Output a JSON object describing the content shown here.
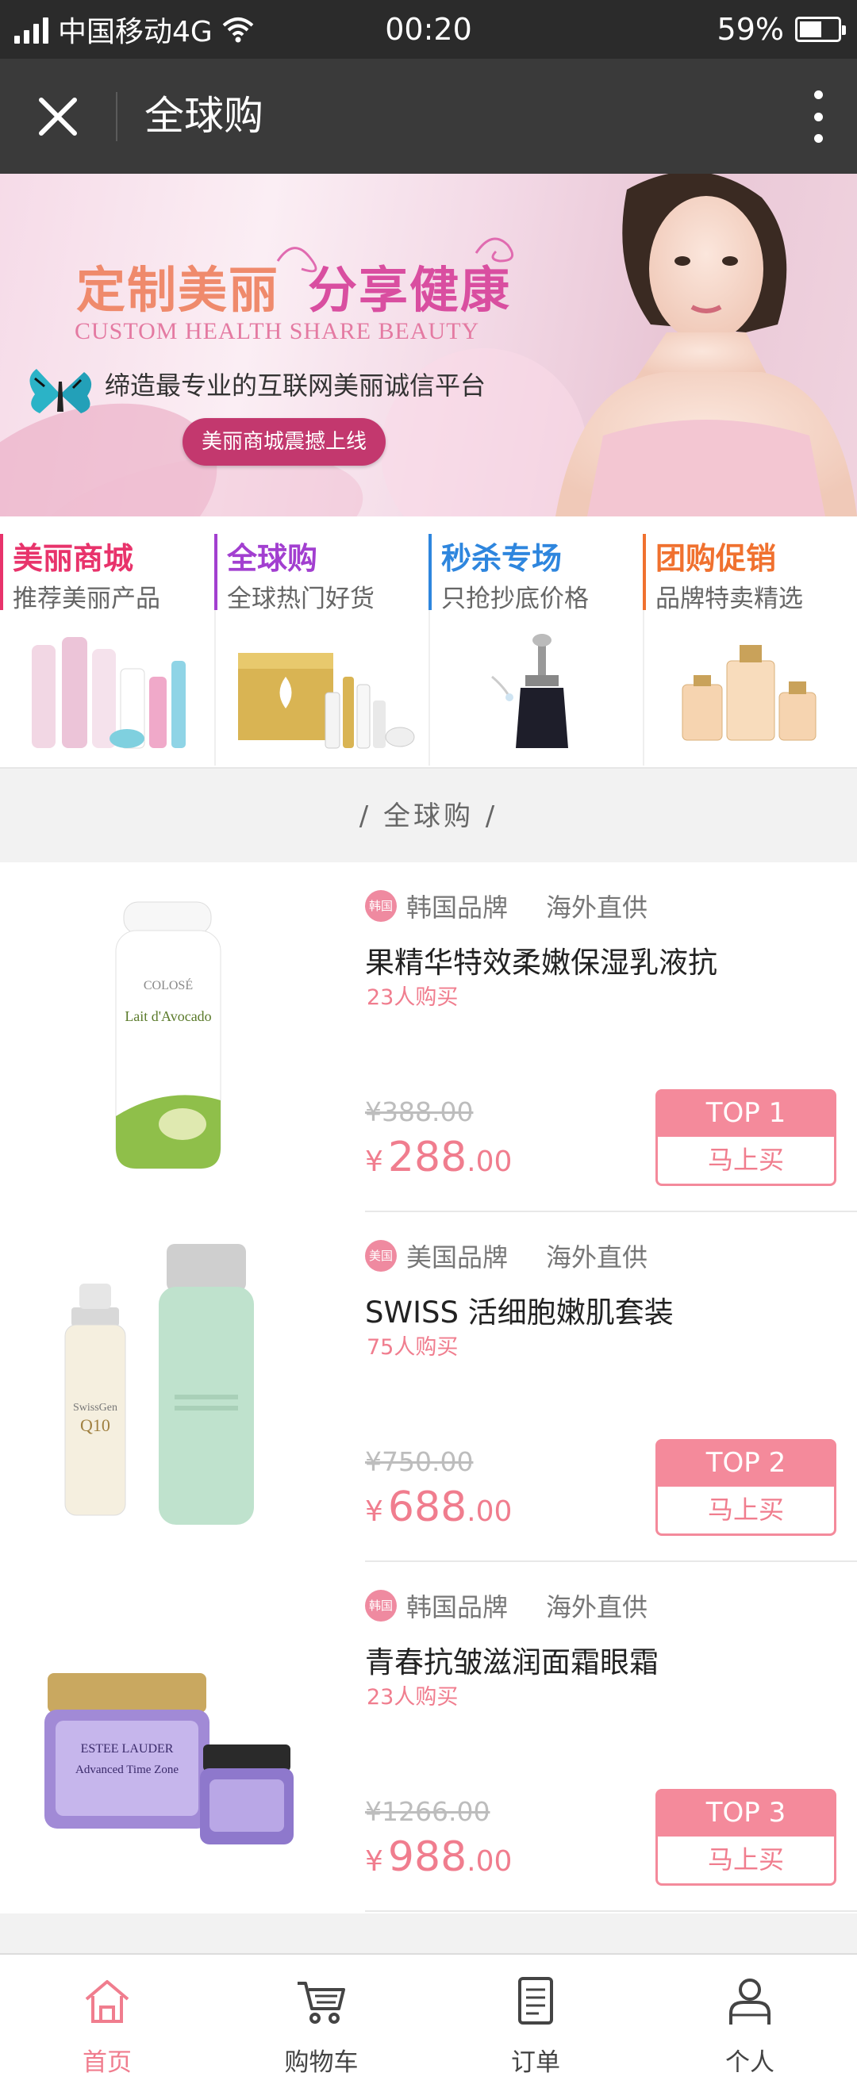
{
  "status_bar": {
    "carrier": "中国移动4G",
    "time": "00:20",
    "battery": "59%",
    "battery_level": 0.59
  },
  "titlebar": {
    "title": "全球购"
  },
  "banner": {
    "title_part1": "定制美丽",
    "title_part2": "分享健康",
    "subtitle": "CUSTOM HEALTH SHARE BEAUTY",
    "description": "缔造最专业的互联网美丽诚信平台",
    "button_label": "美丽商城震撼上线"
  },
  "categories": [
    {
      "name": "美丽商城",
      "desc": "推荐美丽产品",
      "color": "#e8336b"
    },
    {
      "name": "全球购",
      "desc": "全球热门好货",
      "color": "#a23fd0"
    },
    {
      "name": "秒杀专场",
      "desc": "只抢抄底价格",
      "color": "#2e86de"
    },
    {
      "name": "团购促销",
      "desc": "品牌特卖精选",
      "color": "#f0712f"
    }
  ],
  "section": {
    "title": "/ 全球购 /"
  },
  "products": [
    {
      "flag": "韩国",
      "origin": "韩国品牌",
      "supply": "海外直供",
      "name": "果精华特效柔嫩保湿乳液抗",
      "buyers": "23人购买",
      "old_price": "¥388.00",
      "currency": "¥",
      "price_int": "288",
      "price_dec": ".00",
      "rank": "TOP 1",
      "buy_label": "马上买",
      "image_text_brand": "COLOSÉ",
      "image_text_name": "Lait d'Avocado"
    },
    {
      "flag": "美国",
      "origin": "美国品牌",
      "supply": "海外直供",
      "name": "SWISS 活细胞嫩肌套装",
      "buyers": "75人购买",
      "old_price": "¥750.00",
      "currency": "¥",
      "price_int": "688",
      "price_dec": ".00",
      "rank": "TOP 2",
      "buy_label": "马上买",
      "image_text_brand": "SwissGen",
      "image_text_name": "Q10"
    },
    {
      "flag": "韩国",
      "origin": "韩国品牌",
      "supply": "海外直供",
      "name": "青春抗皱滋润面霜眼霜",
      "buyers": "23人购买",
      "old_price": "¥1266.00",
      "currency": "¥",
      "price_int": "988",
      "price_dec": ".00",
      "rank": "TOP 3",
      "buy_label": "马上买",
      "image_text_brand": "ESTEE LAUDER",
      "image_text_name": "Advanced Time Zone"
    }
  ],
  "bottom_nav": [
    {
      "label": "首页",
      "icon": "home-icon",
      "active": true
    },
    {
      "label": "购物车",
      "icon": "cart-icon",
      "active": false
    },
    {
      "label": "订单",
      "icon": "order-icon",
      "active": false
    },
    {
      "label": "个人",
      "icon": "user-icon",
      "active": false
    }
  ],
  "colors": {
    "accent": "#f07d8e",
    "titlebar": "#3a3a3a",
    "statusbar": "#2b2b2b"
  }
}
